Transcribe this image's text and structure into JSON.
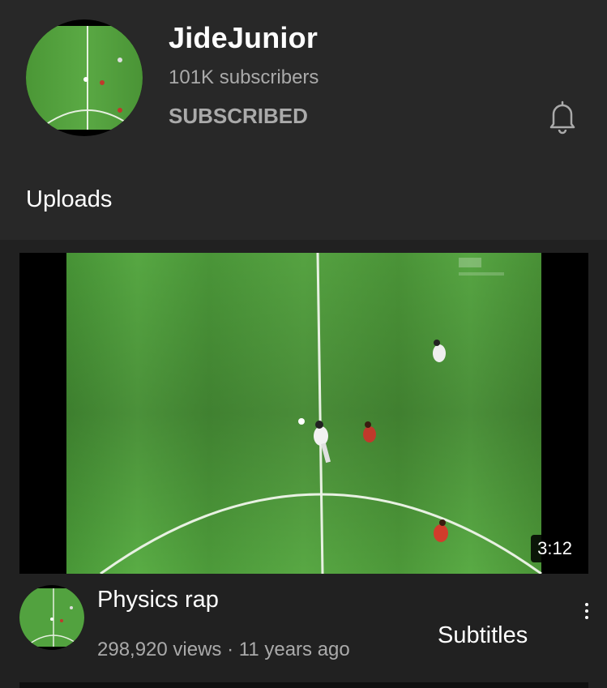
{
  "channel": {
    "name": "JideJunior",
    "subscribers": "101K subscribers",
    "subscribe_state": "SUBSCRIBED",
    "bell_icon": "bell-icon"
  },
  "section": {
    "title": "Uploads"
  },
  "video": {
    "title": "Physics rap",
    "meta": "298,920 views · 11 years ago",
    "duration": "3:12",
    "overlay_text": "Subtitles",
    "menu_icon": "more-vert-icon"
  },
  "colors": {
    "background": "#212121",
    "header_background": "#282828",
    "secondary_text": "#aaaaaa",
    "pitch_green": "#4f9a3b"
  }
}
